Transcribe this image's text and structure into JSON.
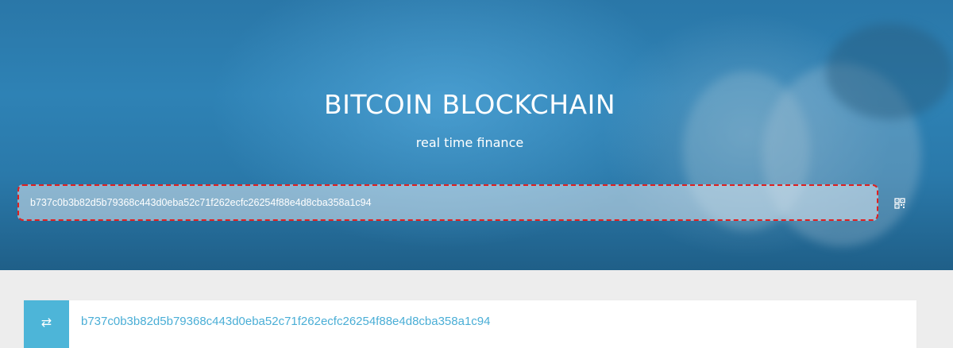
{
  "hero": {
    "title": "BITCOIN BLOCKCHAIN",
    "subtitle": "real time finance"
  },
  "search": {
    "value": "b737c0b3b82d5b79368c443d0eba52c71f262ecfc26254f88e4d8cba358a1c94",
    "qr_icon": "qr-code-icon"
  },
  "result": {
    "icon": "transaction-arrows-icon",
    "icon_glyph": "⇄",
    "hash": "b737c0b3b82d5b79368c443d0eba52c71f262ecfc26254f88e4d8cba358a1c94"
  },
  "colors": {
    "accent": "#4db5d8",
    "link": "#4aaed6",
    "focus_outline": "#e02020"
  }
}
